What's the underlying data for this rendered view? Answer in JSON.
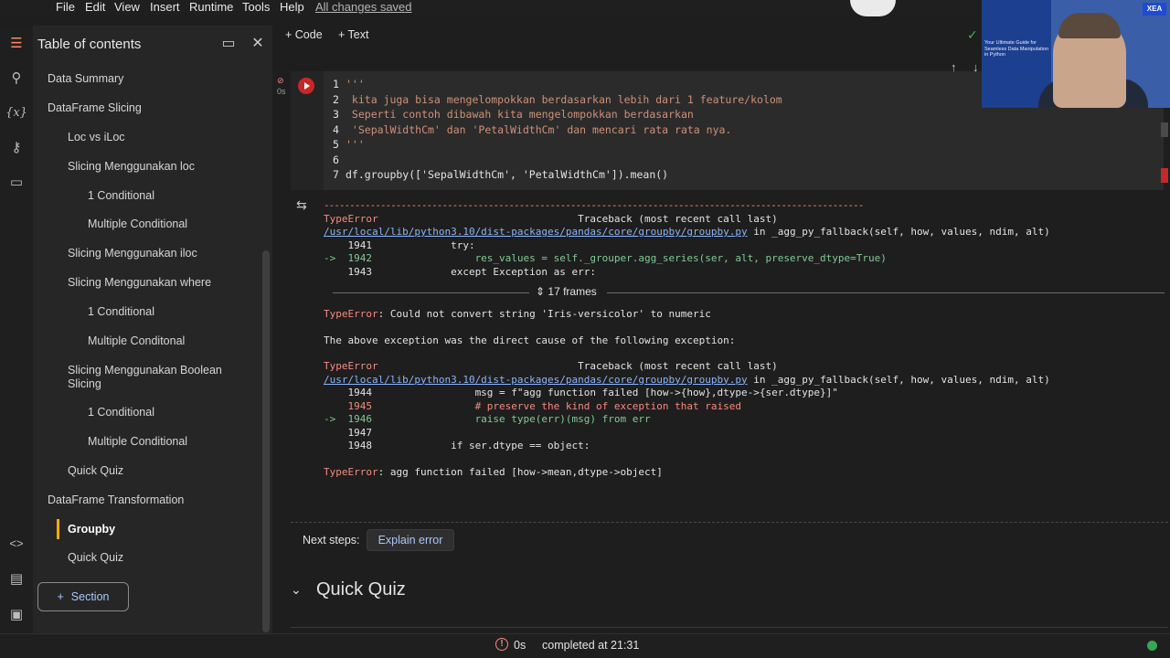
{
  "menu": [
    "File",
    "Edit",
    "View",
    "Insert",
    "Runtime",
    "Tools",
    "Help"
  ],
  "save_status": "All changes saved",
  "toc": {
    "title": "Table of contents",
    "items": [
      {
        "label": "Data Summary",
        "level": 1
      },
      {
        "label": "DataFrame Slicing",
        "level": 1
      },
      {
        "label": "Loc vs iLoc",
        "level": 2
      },
      {
        "label": "Slicing Menggunakan loc",
        "level": 2
      },
      {
        "label": "1 Conditional",
        "level": 3
      },
      {
        "label": "Multiple Conditional",
        "level": 3
      },
      {
        "label": "Slicing Menggunakan iloc",
        "level": 2
      },
      {
        "label": "Slicing Menggunakan where",
        "level": 2
      },
      {
        "label": "1 Conditional",
        "level": 3
      },
      {
        "label": "Multiple Conditonal",
        "level": 3
      },
      {
        "label": "Slicing Menggunakan Boolean Slicing",
        "level": 2
      },
      {
        "label": "1 Conditional",
        "level": 3
      },
      {
        "label": "Multiple Conditional",
        "level": 3
      },
      {
        "label": "Quick Quiz",
        "level": 2
      },
      {
        "label": "DataFrame Transformation",
        "level": 1
      },
      {
        "label": "Groupby",
        "level": 2,
        "active": true
      },
      {
        "label": "Quick Quiz",
        "level": 2
      }
    ],
    "section_button": "Section"
  },
  "toolbar": {
    "code": "+ Code",
    "text": "+ Text"
  },
  "cell": {
    "lines": [
      {
        "n": "1",
        "text": "'''"
      },
      {
        "n": "2",
        "text": " kita juga bisa mengelompokkan berdasarkan lebih dari 1 feature/kolom"
      },
      {
        "n": "3",
        "text": " Seperti contoh dibawah kita mengelompokkan berdasarkan"
      },
      {
        "n": "4",
        "text": " 'SepalWidthCm' dan 'PetalWidthCm' dan mencari rata rata nya."
      },
      {
        "n": "5",
        "text": "'''"
      },
      {
        "n": "6",
        "text": ""
      },
      {
        "n": "7",
        "text": "df.groupby(['SepalWidthCm', 'PetalWidthCm']).mean()"
      }
    ],
    "exec_time": "0s"
  },
  "output": {
    "dashes": "---------------------------------------------------------------------------------------------------------",
    "tb1_header_left": "TypeError",
    "tb1_header_right": "Traceback (most recent call last)",
    "tb1_path": "/usr/local/lib/python3.10/dist-packages/pandas/core/groupby/groupby.py",
    "tb1_in": " in _agg_py_fallback(self, how, values, ndim, alt)",
    "tb1_lines": [
      "    1941             try:",
      "->  1942                 res_values = self._grouper.agg_series(ser, alt, preserve_dtype=True)",
      "    1943             except Exception as err:"
    ],
    "frames": "17 frames",
    "err1_type": "TypeError",
    "err1_msg": ": Could not convert string 'Iris-versicolor' to numeric",
    "cause": "The above exception was the direct cause of the following exception:",
    "tb2_header_left": "TypeError",
    "tb2_header_right": "Traceback (most recent call last)",
    "tb2_path": "/usr/local/lib/python3.10/dist-packages/pandas/core/groupby/groupby.py",
    "tb2_in": " in _agg_py_fallback(self, how, values, ndim, alt)",
    "tb2_lines": [
      "    1944                 msg = f\"agg function failed [how->{how},dtype->{ser.dtype}]\"",
      "    1945                 # preserve the kind of exception that raised",
      "->  1946                 raise type(err)(msg) from err",
      "    1947",
      "    1948             if ser.dtype == object:"
    ],
    "err2_type": "TypeError",
    "err2_msg": ": agg function failed [how->mean,dtype->object]"
  },
  "next_steps": {
    "label": "Next steps:",
    "button": "Explain error"
  },
  "next_section": {
    "title": "Quick Quiz"
  },
  "status_bar": {
    "time": "0s",
    "completed": "completed at 21:31"
  },
  "webcam": {
    "badge": "XEA",
    "slide_text": "Your Ultimate Guide for Seamless Data Manipulation in Python"
  },
  "colors": {
    "error": "#f28b82",
    "link": "#8ab4f8",
    "active": "#f9ab00",
    "run": "#c62828",
    "ok": "#34a853"
  }
}
